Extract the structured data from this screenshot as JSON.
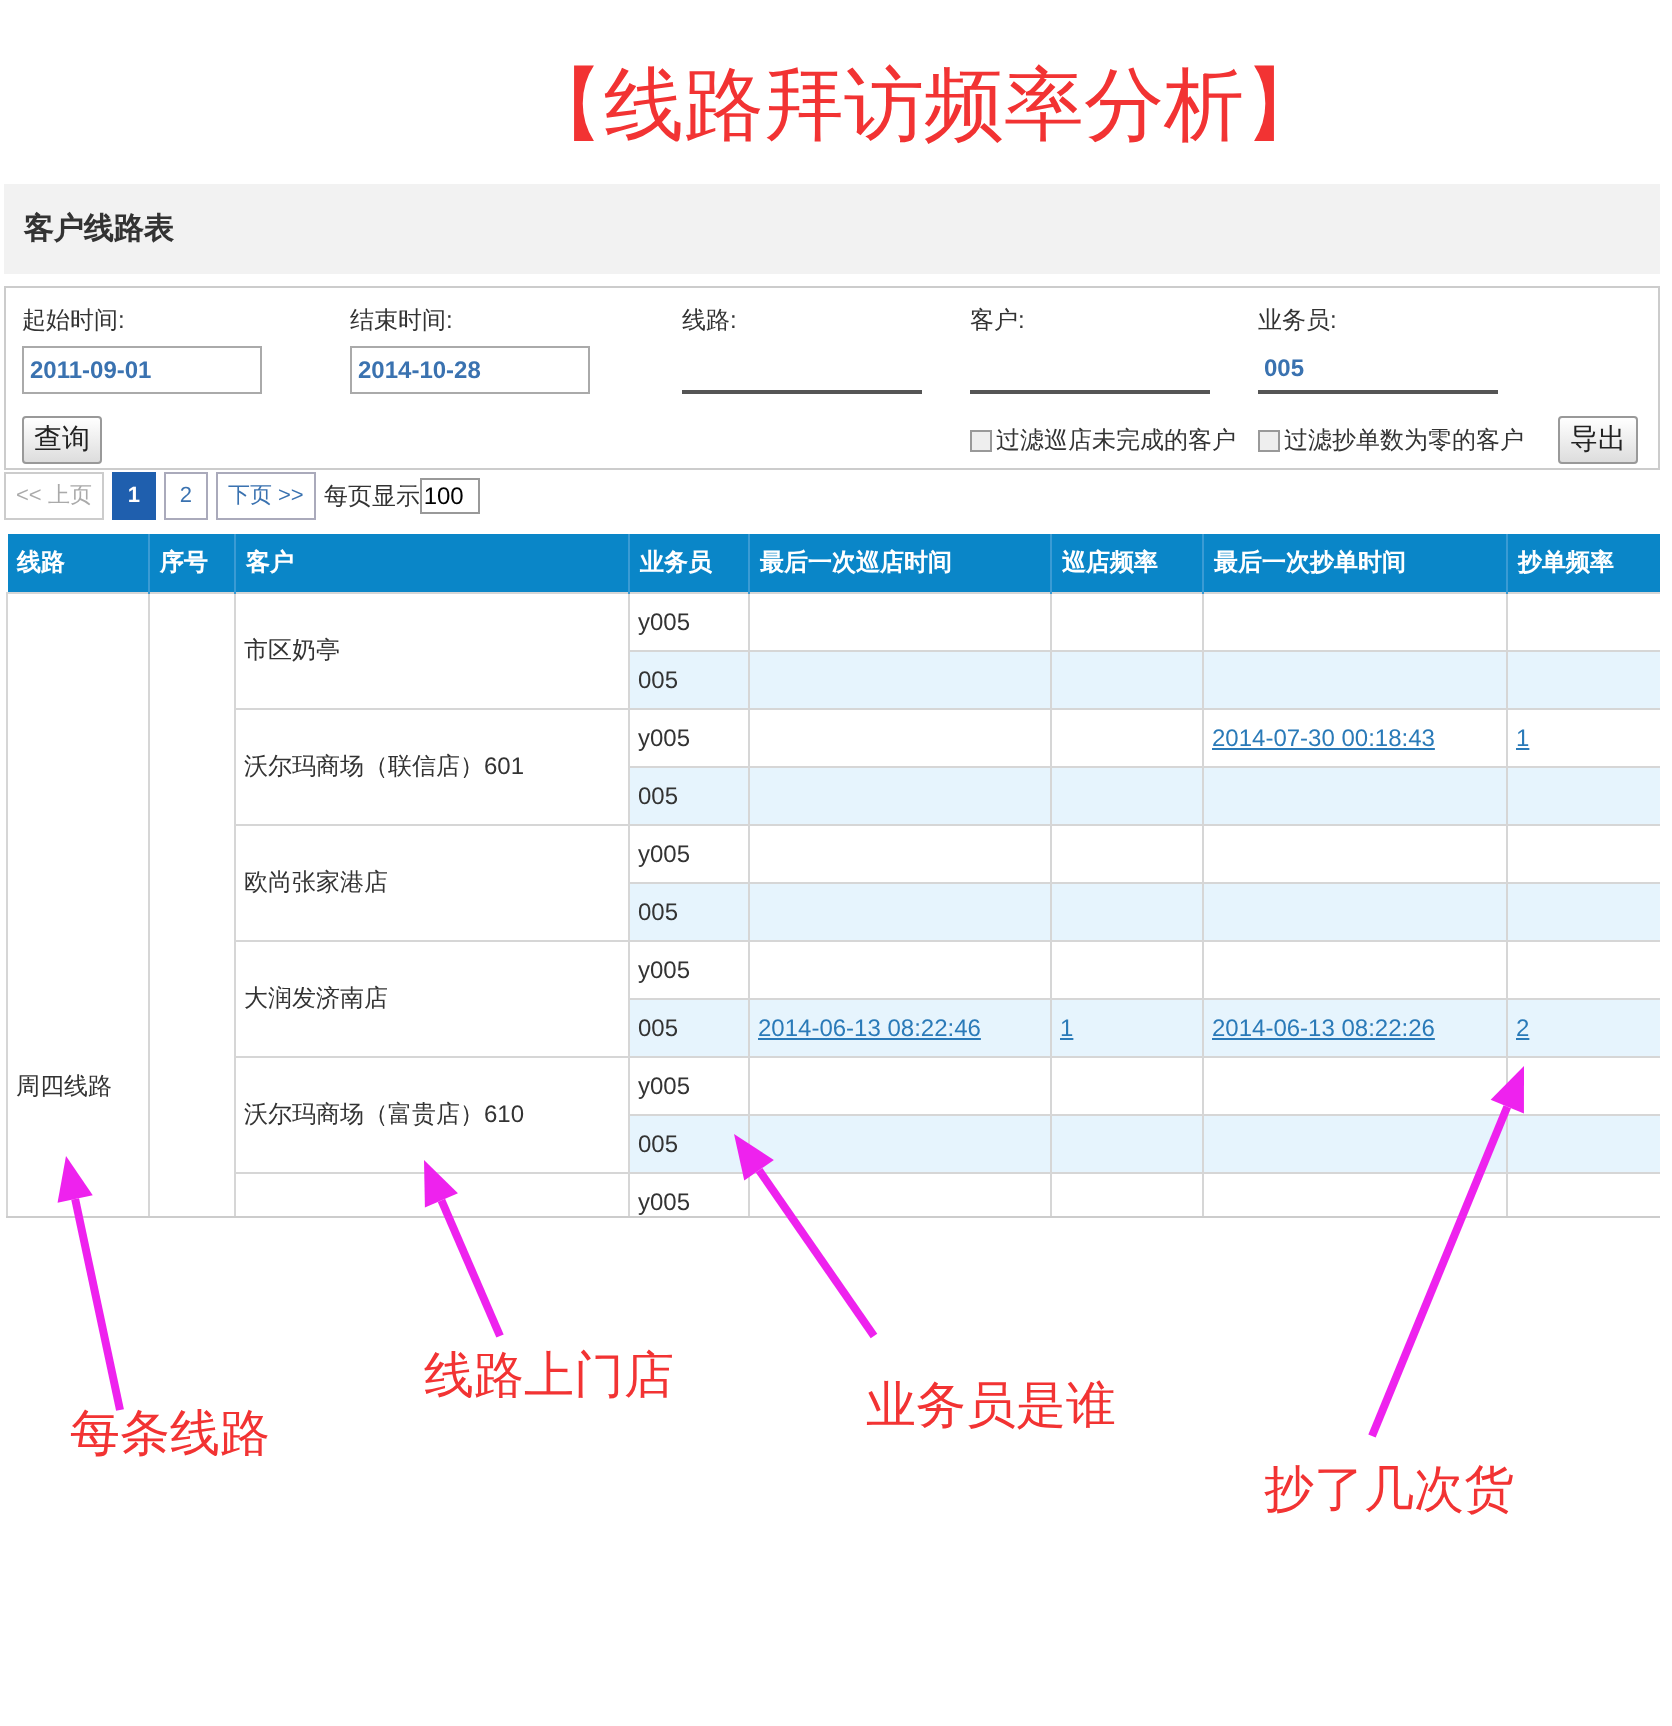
{
  "title": "【线路拜访频率分析】",
  "panel": {
    "title": "客户线路表"
  },
  "filters": [
    {
      "label": "起始时间:",
      "kind": "box",
      "value": "2011-09-01"
    },
    {
      "label": "结束时间:",
      "kind": "box",
      "value": "2014-10-28"
    },
    {
      "label": "线路:",
      "kind": "line"
    },
    {
      "label": "客户:",
      "kind": "line"
    },
    {
      "label": "业务员:",
      "kind": "line",
      "value": "005"
    }
  ],
  "search_button": "查询",
  "checkboxes": [
    {
      "label": "过滤巡店未完成的客户",
      "checked": false
    },
    {
      "label": "过滤抄单数为零的客户",
      "checked": false
    }
  ],
  "export_button": "导出",
  "pagination": {
    "pages": [
      {
        "label": "<< 上页",
        "kind": "nav",
        "disabled": true,
        "selected": false
      },
      {
        "label": "1",
        "kind": "page",
        "disabled": false,
        "selected": true
      },
      {
        "label": "2",
        "kind": "page",
        "disabled": false,
        "selected": false
      },
      {
        "label": "下页 >>",
        "kind": "nav",
        "disabled": false,
        "selected": false
      }
    ],
    "per_page_label": "每页显示",
    "per_page": "100"
  },
  "table": {
    "columns": [
      "线路",
      "序号",
      "客户",
      "业务员",
      "最后一次巡店时间",
      "巡店频率",
      "最后一次抄单时间",
      "抄单频率"
    ],
    "route": "周四线路",
    "customers": [
      {
        "name": "市区奶亭",
        "rows": [
          {
            "rep": "y005"
          },
          {
            "rep": "005"
          }
        ]
      },
      {
        "name": "沃尔玛商场（联信店）601",
        "rows": [
          {
            "rep": "y005",
            "last_order": "2014-07-30 00:18:43",
            "order_freq": "1"
          },
          {
            "rep": "005"
          }
        ]
      },
      {
        "name": "欧尚张家港店",
        "rows": [
          {
            "rep": "y005"
          },
          {
            "rep": "005"
          }
        ]
      },
      {
        "name": "大润发济南店",
        "rows": [
          {
            "rep": "y005"
          },
          {
            "rep": "005",
            "last_visit": "2014-06-13 08:22:46",
            "visit_freq": "1",
            "last_order": "2014-06-13 08:22:26",
            "order_freq": "2"
          }
        ]
      },
      {
        "name": "沃尔玛商场（富贵店）610",
        "rows": [
          {
            "rep": "y005"
          },
          {
            "rep": "005"
          }
        ]
      },
      {
        "rows": [
          {
            "rep": "y005"
          }
        ]
      }
    ]
  },
  "annotations": [
    "每条线路",
    "线路上门店",
    "业务员是谁",
    "抄了几次货"
  ]
}
